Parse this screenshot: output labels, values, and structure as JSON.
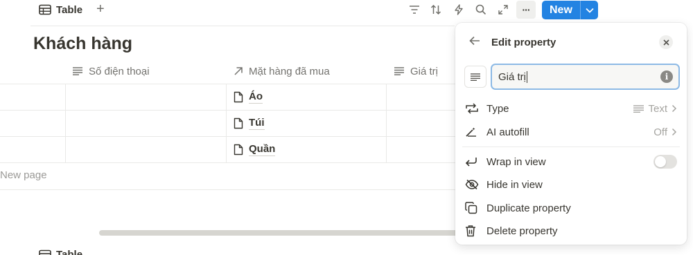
{
  "toolbar": {
    "view_label": "Table",
    "add_view": "+",
    "new_label": "New",
    "more": "···"
  },
  "page": {
    "title": "Khách hàng"
  },
  "table": {
    "columns": [
      {
        "label": "Số điện thoại",
        "icon": "text-icon"
      },
      {
        "label": "Mặt hàng đã mua",
        "icon": "relation-arrow-icon"
      },
      {
        "label": "Giá trị",
        "icon": "text-icon"
      }
    ],
    "items": [
      "Áo",
      "Túi",
      "Quần"
    ],
    "new_page": "New page"
  },
  "second_view": {
    "label": "Table"
  },
  "panel": {
    "title": "Edit property",
    "name_value": "Giá trị",
    "info": "i",
    "type_label": "Type",
    "type_value": "Text",
    "ai_label": "AI autofill",
    "ai_value": "Off",
    "wrap_label": "Wrap in view",
    "wrap_on": false,
    "hide_label": "Hide in view",
    "duplicate_label": "Duplicate property",
    "delete_label": "Delete property"
  },
  "colors": {
    "accent": "#2383e2",
    "input_focus": "#8cb9e5"
  }
}
